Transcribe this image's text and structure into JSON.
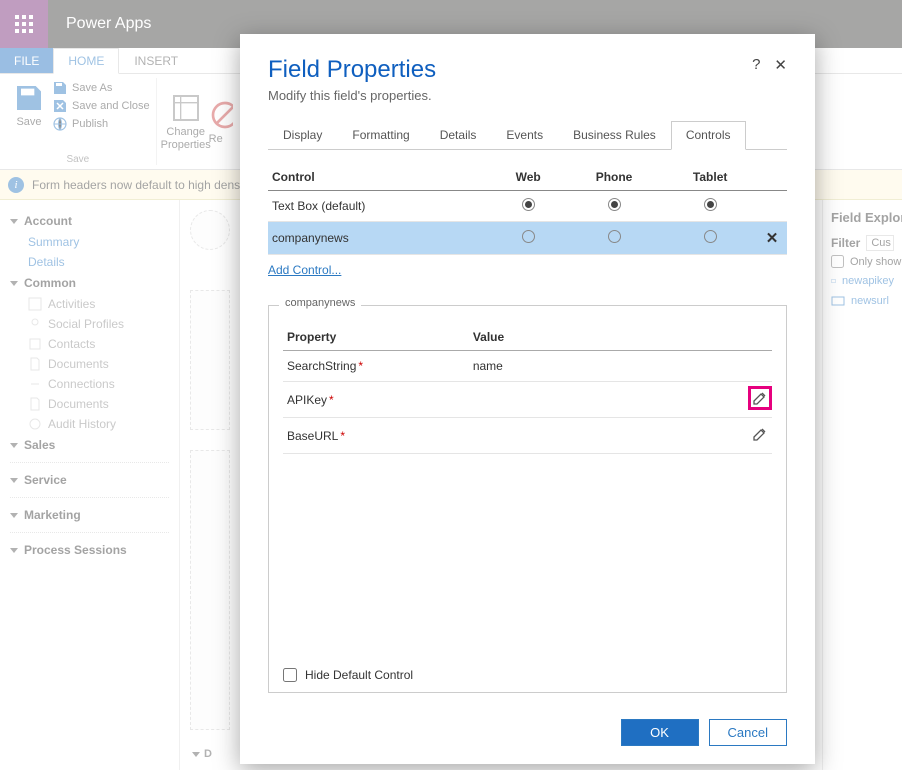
{
  "app": {
    "title": "Power Apps"
  },
  "ribbon": {
    "file": "FILE",
    "tabs": [
      {
        "label": "HOME",
        "active": true
      },
      {
        "label": "INSERT",
        "active": false
      }
    ],
    "save": "Save",
    "save_as": "Save As",
    "save_close": "Save and Close",
    "publish": "Publish",
    "group_save": "Save",
    "change_props": "Change Properties",
    "re": "Re"
  },
  "infobar": {
    "text": "Form headers now default to high dens"
  },
  "leftnav": {
    "sections": [
      {
        "title": "Account",
        "items": [
          {
            "label": "Summary",
            "link": true
          },
          {
            "label": "Details",
            "link": true
          }
        ]
      },
      {
        "title": "Common",
        "items": [
          {
            "label": "Activities"
          },
          {
            "label": "Social Profiles"
          },
          {
            "label": "Contacts"
          },
          {
            "label": "Documents"
          },
          {
            "label": "Connections"
          },
          {
            "label": "Documents"
          },
          {
            "label": "Audit History"
          }
        ]
      },
      {
        "title": "Sales",
        "items": []
      },
      {
        "title": "Service",
        "items": []
      },
      {
        "title": "Marketing",
        "items": []
      },
      {
        "title": "Process Sessions",
        "items": []
      }
    ]
  },
  "canvas": {
    "section_prefix": "D"
  },
  "rightpanel": {
    "title": "Field Explorer",
    "filter_label": "Filter",
    "filter_btn": "Cus",
    "only_show": "Only show u",
    "fields": [
      "newapikey",
      "newsurl"
    ]
  },
  "modal": {
    "title": "Field Properties",
    "subtitle": "Modify this field's properties.",
    "help": "?",
    "close": "✕",
    "tabs": [
      "Display",
      "Formatting",
      "Details",
      "Events",
      "Business Rules",
      "Controls"
    ],
    "active_tab": 5,
    "ctrl_headers": {
      "control": "Control",
      "web": "Web",
      "phone": "Phone",
      "tablet": "Tablet"
    },
    "ctrl_rows": [
      {
        "name": "Text Box (default)",
        "web": true,
        "phone": true,
        "tablet": true,
        "selected": false,
        "removable": false
      },
      {
        "name": "companynews",
        "web": false,
        "phone": false,
        "tablet": false,
        "selected": true,
        "removable": true
      }
    ],
    "add_control": "Add Control...",
    "prop_legend": "companynews",
    "prop_headers": {
      "property": "Property",
      "value": "Value"
    },
    "prop_rows": [
      {
        "name": "SearchString",
        "required": true,
        "value": "name",
        "edit": false
      },
      {
        "name": "APIKey",
        "required": true,
        "value": "",
        "edit": true,
        "highlight": true
      },
      {
        "name": "BaseURL",
        "required": true,
        "value": "",
        "edit": true,
        "highlight": false
      }
    ],
    "hide_default": "Hide Default Control",
    "ok": "OK",
    "cancel": "Cancel"
  }
}
